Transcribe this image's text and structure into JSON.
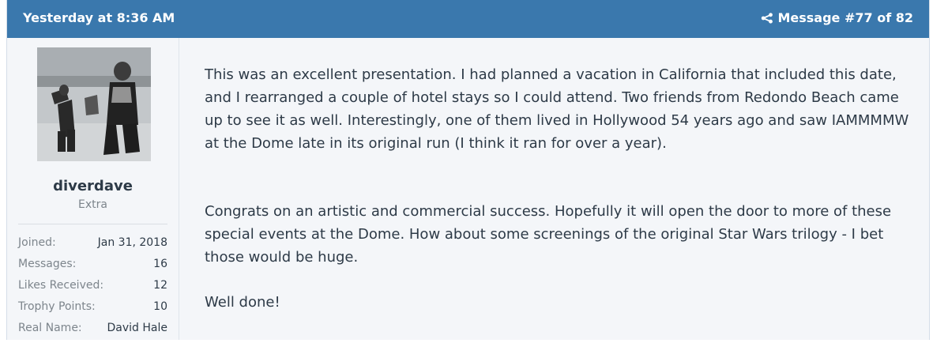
{
  "header": {
    "date": "Yesterday at 8:36 AM",
    "message_label": "Message #77 of 82",
    "share_icon": "share-icon",
    "bg_color": "#3a78ad"
  },
  "user": {
    "username": "diverdave",
    "title": "Extra",
    "avatar_icon": "avatar-photo",
    "stats": [
      {
        "label": "Joined:",
        "value": "Jan 31, 2018"
      },
      {
        "label": "Messages:",
        "value": "16"
      },
      {
        "label": "Likes Received:",
        "value": "12"
      },
      {
        "label": "Trophy Points:",
        "value": "10"
      },
      {
        "label": "Real Name:",
        "value": "David Hale"
      }
    ]
  },
  "message": {
    "paragraphs": [
      "This was an excellent presentation. I had planned a vacation in California that included this date, and I rearranged a couple of hotel stays so I could attend. Two friends from Redondo Beach came up to see it as well. Interestingly, one of them lived in Hollywood 54 years ago and saw IAMMMMW at the Dome late in its original run (I think it ran for over a year).",
      "Congrats on an artistic and commercial success. Hopefully it will open the door to more of these special events at the Dome. How about some screenings of the original Star Wars trilogy - I bet those would be huge.",
      "Well done!"
    ]
  }
}
